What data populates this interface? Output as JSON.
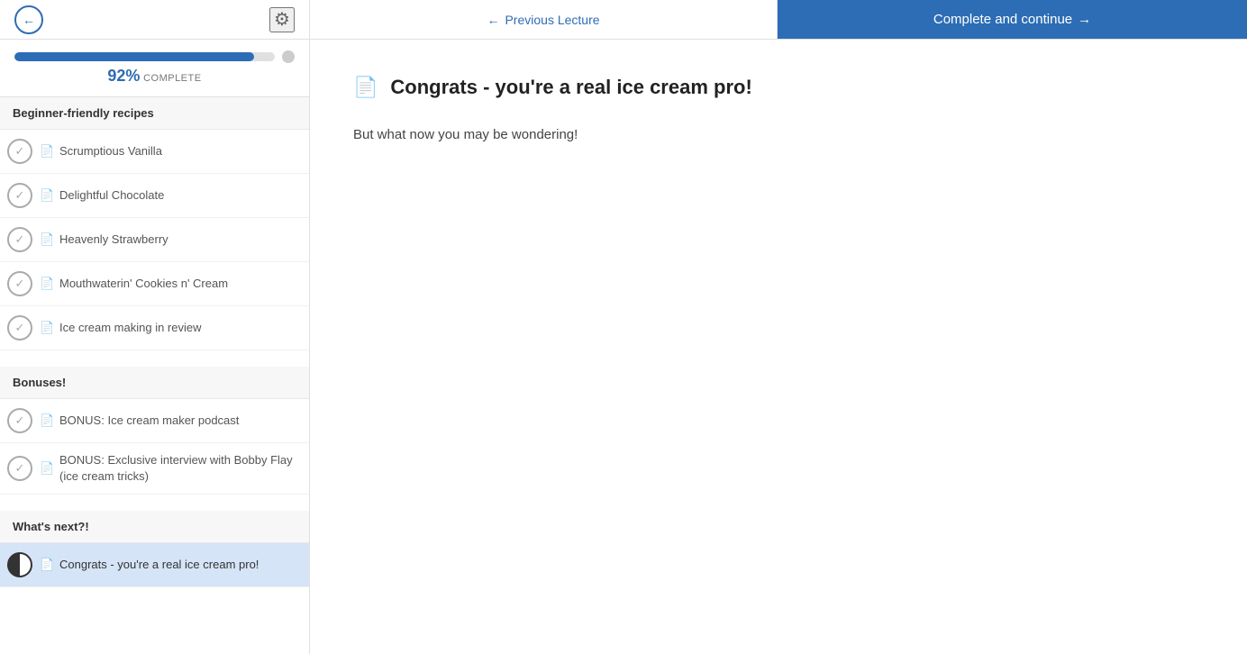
{
  "nav": {
    "back_label": "←",
    "gear_label": "⚙",
    "previous_label": "Previous Lecture",
    "complete_label": "Complete and continue"
  },
  "progress": {
    "percent": "92%",
    "percent_value": 92,
    "complete_label": "COMPLETE"
  },
  "sections": [
    {
      "id": "beginner",
      "title": "Beginner-friendly recipes",
      "lessons": [
        {
          "id": "vanilla",
          "title": "Scrumptious Vanilla",
          "checked": true,
          "active": false
        },
        {
          "id": "chocolate",
          "title": "Delightful Chocolate",
          "checked": true,
          "active": false
        },
        {
          "id": "strawberry",
          "title": "Heavenly Strawberry",
          "checked": true,
          "active": false
        },
        {
          "id": "cookies",
          "title": "Mouthwaterin' Cookies n' Cream",
          "checked": true,
          "active": false
        },
        {
          "id": "review",
          "title": "Ice cream making in review",
          "checked": true,
          "active": false
        }
      ]
    },
    {
      "id": "bonuses",
      "title": "Bonuses!",
      "lessons": [
        {
          "id": "podcast",
          "title": "BONUS: Ice cream maker podcast",
          "checked": true,
          "active": false
        },
        {
          "id": "interview",
          "title": "BONUS: Exclusive interview with Bobby Flay (ice cream tricks)",
          "checked": true,
          "active": false
        }
      ]
    },
    {
      "id": "whatsnext",
      "title": "What's next?!",
      "lessons": [
        {
          "id": "congrats",
          "title": "Congrats - you're a real ice cream pro!",
          "checked": false,
          "active": true,
          "half": true
        }
      ]
    }
  ],
  "content": {
    "title": "Congrats - you're a real ice cream pro!",
    "body": "But what now you may be wondering!"
  }
}
